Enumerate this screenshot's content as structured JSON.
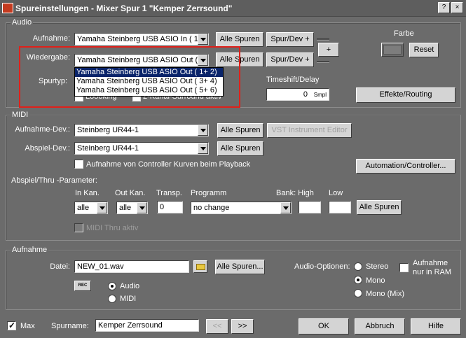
{
  "window": {
    "title": "Spureinstellungen - Mixer Spur 1 \"Kemper Zerrsound\"",
    "help_btn": "?",
    "close_btn": "×"
  },
  "audio": {
    "group_label": "Audio",
    "aufnahme_label": "Aufnahme:",
    "aufnahme_value": "Yamaha Steinberg USB ASIO In ( 1 )",
    "alle_spuren": "Alle Spuren",
    "spur_dev": "Spur/Dev +",
    "wiedergabe_label": "Wiedergabe:",
    "wiedergabe_value": "Yamaha Steinberg USB ASIO Out ( 1+",
    "plus_btn": "+",
    "spurtyp_label": "Spurtyp:",
    "hidden_row_text": "Loooking",
    "kanal_text": "2-Kanal-Surround aktiv",
    "timeshift_label": "Timeshift/Delay",
    "timeshift_value": "0",
    "timeshift_unit": "Smpl",
    "farbe_label": "Farbe",
    "reset_btn": "Reset",
    "effekte_btn": "Effekte/Routing",
    "dropdown_options": [
      "Yamaha Steinberg USB ASIO Out ( 1+ 2)",
      "Yamaha Steinberg USB ASIO Out ( 3+ 4)",
      "Yamaha Steinberg USB ASIO Out ( 5+ 6)"
    ]
  },
  "midi": {
    "group_label": "MIDI",
    "aufnahme_dev_label": "Aufnahme-Dev.:",
    "aufnahme_dev_value": "Steinberg UR44-1",
    "alle_spuren": "Alle Spuren",
    "vst_editor": "VST Instrument Editor",
    "abspiel_dev_label": "Abspiel-Dev.:",
    "abspiel_dev_value": "Steinberg UR44-1",
    "controller_check": "Aufnahme von Controller Kurven beim Playback",
    "automation_btn": "Automation/Controller...",
    "params_label": "Abspiel/Thru -Parameter:",
    "in_kan_label": "In Kan.",
    "out_kan_label": "Out Kan.",
    "transp_label": "Transp.",
    "programm_label": "Programm",
    "bank_high_label": "Bank: High",
    "low_label": "Low",
    "in_kan_value": "alle",
    "out_kan_value": "alle",
    "transp_value": "0",
    "programm_value": "no change",
    "thru_check": "MIDI Thru aktiv"
  },
  "aufnahme": {
    "group_label": "Aufnahme",
    "datei_label": "Datei:",
    "datei_value": "NEW_01.wav",
    "alle_spuren_btn": "Alle Spuren...",
    "rec_label": "REC",
    "audio_radio": "Audio",
    "midi_radio": "MIDI",
    "audio_optionen_label": "Audio-Optionen:",
    "stereo": "Stereo",
    "mono": "Mono",
    "mono_mix": "Mono (Mix)",
    "ram_label_1": "Aufnahme",
    "ram_label_2": "nur in RAM"
  },
  "footer": {
    "max_label": "Max",
    "spurname_label": "Spurname:",
    "spurname_value": "Kemper Zerrsound",
    "prev_btn": "<<",
    "next_btn": ">>",
    "ok_btn": "OK",
    "abbruch_btn": "Abbruch",
    "hilfe_btn": "Hilfe"
  },
  "colors": {
    "highlight_frame": "#e0201a",
    "window_bg": "#6b6b6b",
    "dropdown_selection": "#0a246a"
  }
}
